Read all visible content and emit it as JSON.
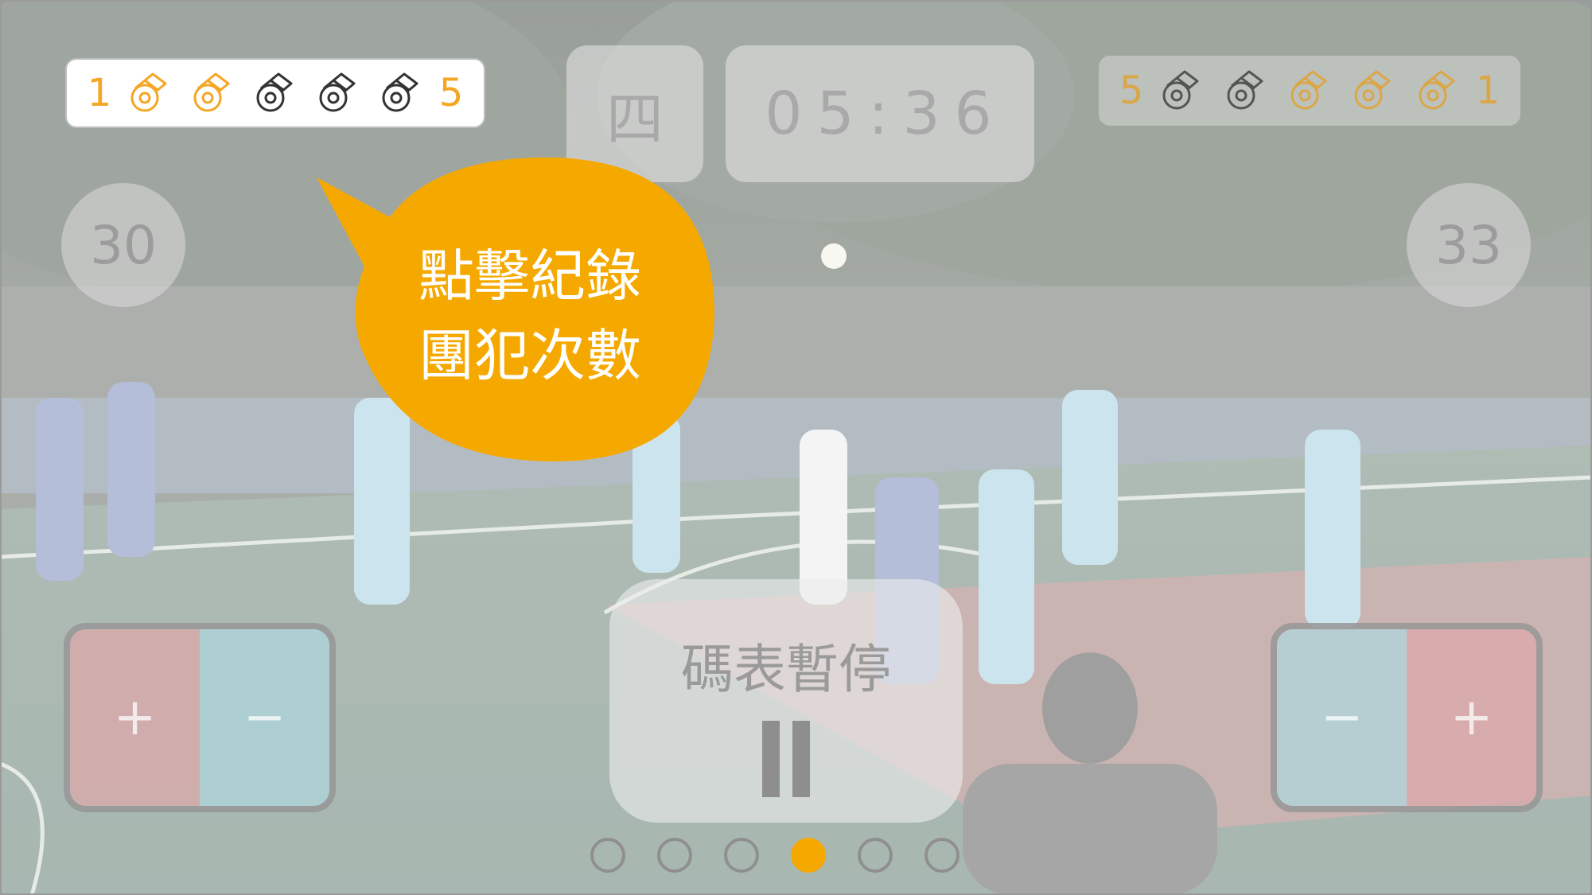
{
  "left_team": {
    "score": "30",
    "foul_start_label": "1",
    "foul_end_label": "5",
    "fouls_committed": 2,
    "fouls_max": 5
  },
  "right_team": {
    "score": "33",
    "foul_start_label": "5",
    "foul_end_label": "1",
    "fouls_committed": 3,
    "fouls_max": 5
  },
  "quarter": "四",
  "game_clock": "05:36",
  "tooltip": {
    "line1": "點擊紀錄",
    "line2": "團犯次數"
  },
  "pause": {
    "label": "碼表暫停"
  },
  "pad": {
    "plus": "+",
    "minus": "−"
  },
  "pager": {
    "count": 6,
    "active_index": 3
  },
  "colors": {
    "accent": "#f5a623",
    "bubble": "#f5a900",
    "whistle_active": "#f5a623",
    "whistle_inactive": "#333333",
    "pad_plus": "#dcaaaa",
    "pad_minus": "#afd7dc"
  },
  "icons": {
    "foul": "whistle-icon",
    "pause": "pause-icon"
  }
}
